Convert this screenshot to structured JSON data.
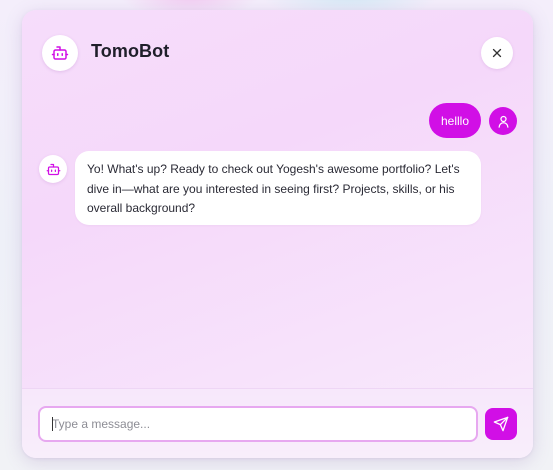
{
  "header": {
    "title": "TomoBot",
    "bot_icon": "robot-icon",
    "close_icon": "close-icon"
  },
  "messages": [
    {
      "role": "user",
      "text": "helllo",
      "avatar_icon": "user-icon"
    },
    {
      "role": "bot",
      "text": "Yo! What's up? Ready to check out Yogesh's awesome portfolio? Let's dive in—what are you interested in seeing first? Projects, skills, or his overall background?",
      "avatar_icon": "robot-icon"
    }
  ],
  "composer": {
    "placeholder": "Type a message...",
    "value": "",
    "send_icon": "send-icon"
  },
  "colors": {
    "accent": "#d10fe6",
    "window_bg": "#f6ddfb",
    "input_border": "#e7a8f0",
    "text_dark": "#1f1f2a"
  }
}
